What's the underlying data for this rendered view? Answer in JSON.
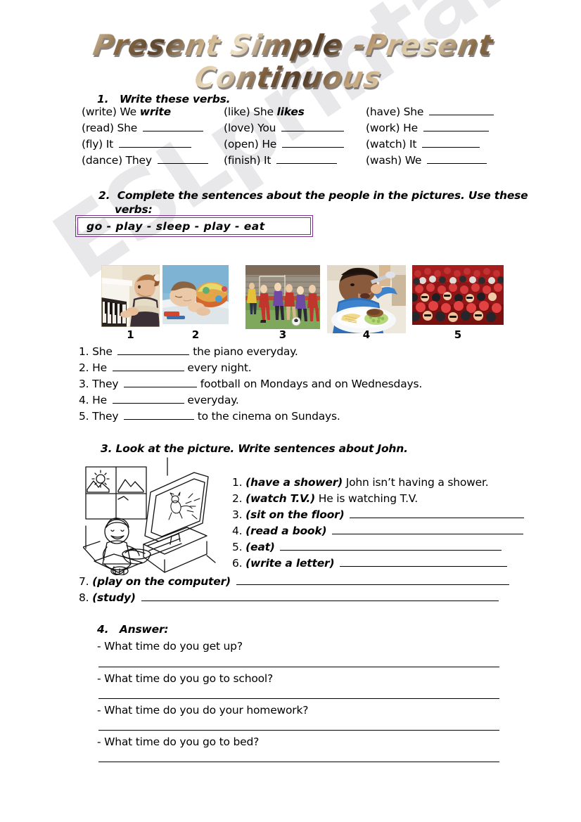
{
  "meta": {
    "title": "Present Simple -Present Continuous",
    "watermark": "ESLprintables.com",
    "accent_purple": "#7b2f8f",
    "ink": "#000000",
    "paper": "#ffffff"
  },
  "exercise1": {
    "number": "1.",
    "instruction": "Write these verbs.",
    "rows": [
      [
        {
          "verb": "(write)",
          "subject": "We",
          "answer": "write",
          "filled": true
        },
        {
          "verb": "(like)",
          "subject": "She",
          "answer": "likes",
          "filled": true
        },
        {
          "verb": "(have)",
          "subject": "She",
          "answer": "",
          "filled": false
        }
      ],
      [
        {
          "verb": "(read)",
          "subject": "She",
          "answer": "",
          "filled": false
        },
        {
          "verb": "(love)",
          "subject": "You",
          "answer": "",
          "filled": false
        },
        {
          "verb": "(work)",
          "subject": "He",
          "answer": "",
          "filled": false
        }
      ],
      [
        {
          "verb": "(fly)",
          "subject": "It",
          "answer": "",
          "filled": false
        },
        {
          "verb": "(open)",
          "subject": "He",
          "answer": "",
          "filled": false
        },
        {
          "verb": "(watch)",
          "subject": "It",
          "answer": "",
          "filled": false
        }
      ],
      [
        {
          "verb": "(dance)",
          "subject": "They",
          "answer": "",
          "filled": false
        },
        {
          "verb": "(finish)",
          "subject": "It",
          "answer": "",
          "filled": false
        },
        {
          "verb": "(wash)",
          "subject": "We",
          "answer": "",
          "filled": false
        }
      ]
    ]
  },
  "exercise2": {
    "number": "2.",
    "instruction_line1": "Complete the sentences about the people in the pictures. Use these",
    "instruction_line2": "verbs:",
    "verbs_box": "go  -  play  -  sleep  -  play  -  eat",
    "verbs_list": [
      "go",
      "play",
      "sleep",
      "play",
      "eat"
    ],
    "pictures": [
      {
        "number": "1",
        "alt": "girl-playing-piano"
      },
      {
        "number": "2",
        "alt": "child-sleeping-in-bed"
      },
      {
        "number": "3",
        "alt": "children-playing-football"
      },
      {
        "number": "4",
        "alt": "boy-eating-meal"
      },
      {
        "number": "5",
        "alt": "cinema-audience"
      }
    ],
    "sentences": [
      {
        "num": "1.",
        "before": "She",
        "after": "the piano everyday."
      },
      {
        "num": "2.",
        "before": "He",
        "after": "every night."
      },
      {
        "num": "3.",
        "before": "They",
        "after": "football on Mondays and on Wednesdays."
      },
      {
        "num": "4.",
        "before": "He",
        "after": "everyday."
      },
      {
        "num": "5.",
        "before": "They",
        "after": "to the cinema on Sundays."
      }
    ]
  },
  "exercise3": {
    "number": "3.",
    "instruction": "Look at the picture. Write sentences about John.",
    "picture_alt": "john-sitting-on-rug-watching-tv-with-bowl",
    "items": [
      {
        "num": "1.",
        "cue": "(have a shower)",
        "answer": "John isn’t having a shower.",
        "filled": true
      },
      {
        "num": "2.",
        "cue": "(watch T.V.)",
        "answer": "He is watching T.V.",
        "filled": true
      },
      {
        "num": "3.",
        "cue": "(sit on the floor)",
        "answer": "",
        "filled": false
      },
      {
        "num": "4.",
        "cue": "(read a book)",
        "answer": "",
        "filled": false
      },
      {
        "num": "5.",
        "cue": "(eat)",
        "answer": "",
        "filled": false
      },
      {
        "num": "6.",
        "cue": "(write a letter)",
        "answer": "",
        "filled": false
      },
      {
        "num": "7.",
        "cue": "(play on the computer)",
        "answer": "",
        "filled": false
      },
      {
        "num": "8.",
        "cue": "(study)",
        "answer": "",
        "filled": false
      }
    ]
  },
  "exercise4": {
    "number": "4.",
    "instruction": "Answer:",
    "questions": [
      "- What time do you get up?",
      "- What time do you go to school?",
      "- What time do you do your homework?",
      "- What time do you go to bed?"
    ]
  }
}
